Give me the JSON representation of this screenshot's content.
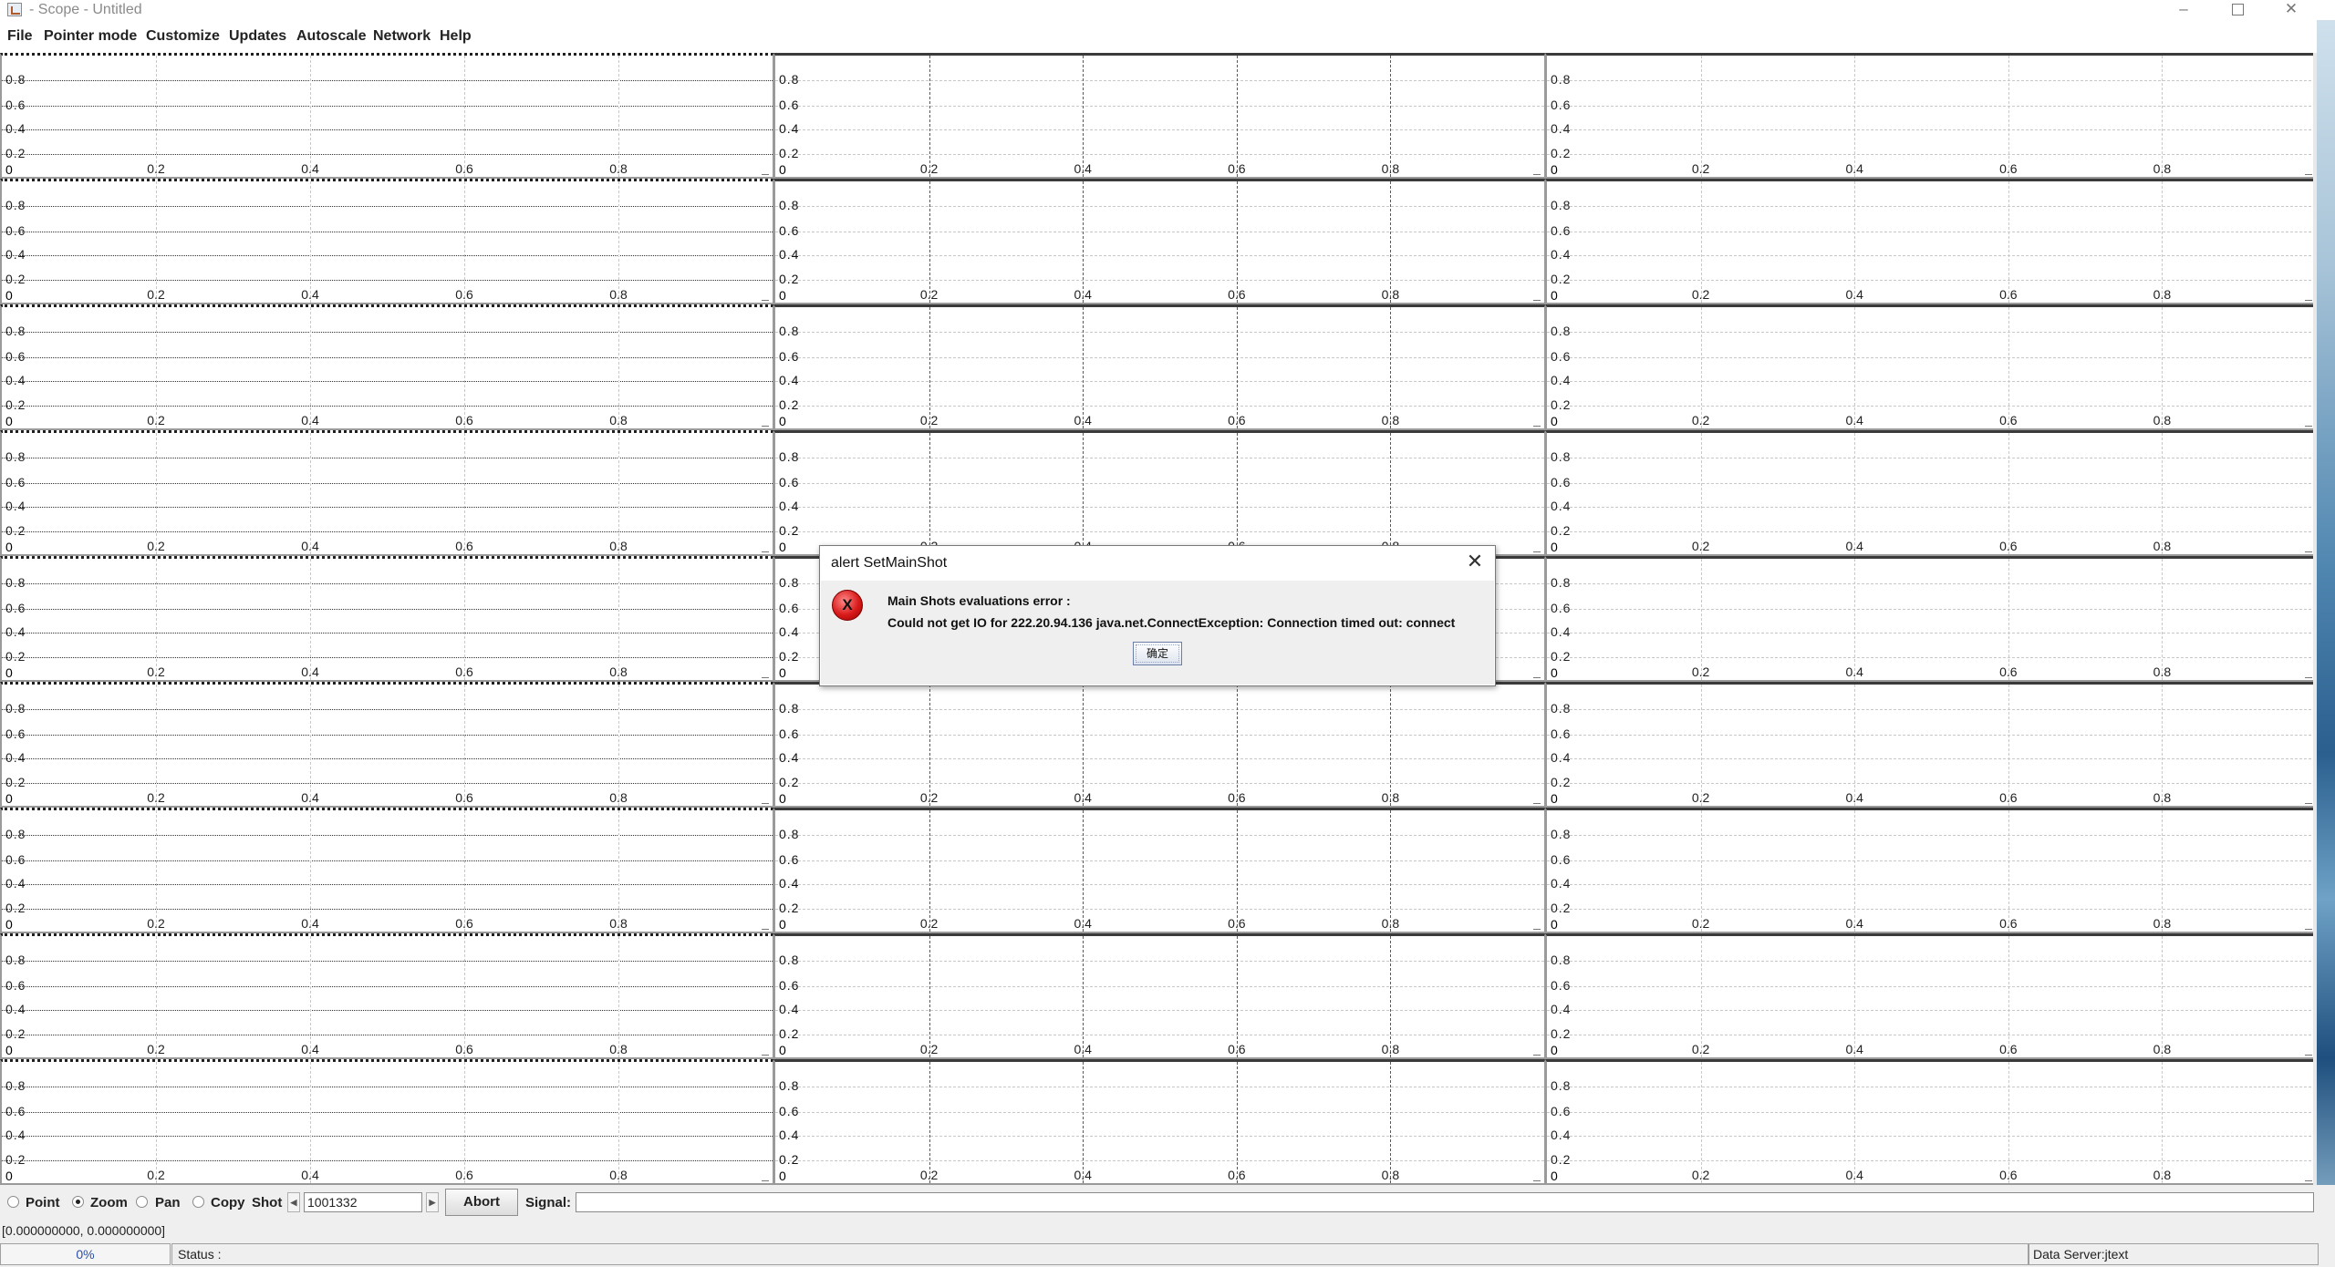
{
  "window": {
    "title": "- Scope - Untitled",
    "controls": {
      "minimize": "–",
      "close": "✕"
    }
  },
  "menu": [
    "File",
    "Pointer mode",
    "Customize",
    "Updates",
    "Autoscale",
    "Network",
    "Help"
  ],
  "plot_grid": {
    "rows": 9,
    "columns": 3,
    "y_ticks": [
      "0.8",
      "0.6",
      "0.4",
      "0.2"
    ],
    "y_zero": "0",
    "x_ticks": [
      "0.2",
      "0.4",
      "0.6",
      "0.8"
    ]
  },
  "dialog": {
    "title": "alert SetMainShot",
    "close_glyph": "✕",
    "icon": "error-icon",
    "icon_glyph": "X",
    "message_line1": "Main Shots evaluations error :",
    "message_line2": "Could not get IO for 222.20.94.136 java.net.ConnectException: Connection timed out: connect",
    "ok_label": "确定"
  },
  "toolbar": {
    "modes": [
      {
        "label": "Point",
        "selected": false
      },
      {
        "label": "Zoom",
        "selected": true
      },
      {
        "label": "Pan",
        "selected": false
      },
      {
        "label": "Copy",
        "selected": false
      }
    ],
    "shot_label": "Shot",
    "shot_value": "1001332",
    "prev_glyph": "◀",
    "next_glyph": "▶",
    "abort_label": "Abort",
    "signal_label": "Signal:",
    "signal_value": ""
  },
  "coordinates": "[0.000000000, 0.000000000]",
  "status": {
    "progress": "0%",
    "progress_value": 0,
    "status_text": "Status :",
    "data_server": "Data Server:jtext"
  }
}
